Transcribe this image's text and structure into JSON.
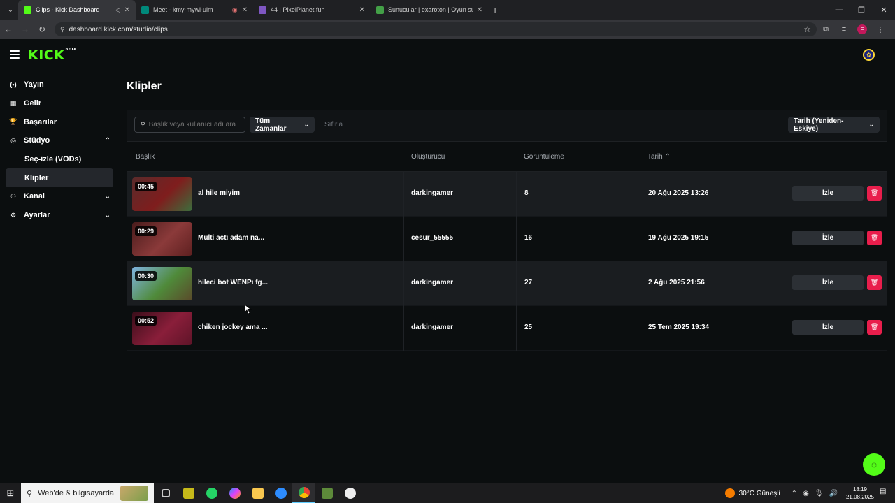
{
  "browser": {
    "tabs": [
      {
        "title": "Clips - Kick Dashboard",
        "favicon_color": "#53fc18",
        "active": true
      },
      {
        "title": "Meet - kmy-mywi-uim",
        "favicon_color": "#00897b",
        "active": false
      },
      {
        "title": "44 | PixelPlanet.fun",
        "favicon_color": "#7e57c2",
        "active": false
      },
      {
        "title": "Sunucular | exaroton | Oyun sunu",
        "favicon_color": "#43a047",
        "active": false
      }
    ],
    "url": "dashboard.kick.com/studio/clips",
    "profile_initial": "F"
  },
  "app": {
    "logo": "KICK",
    "logo_badge": "BETA",
    "brand_color": "#53fc18",
    "sidebar": [
      {
        "label": "Yayın",
        "icon": "broadcast-icon",
        "glyph": "(•)"
      },
      {
        "label": "Gelir",
        "icon": "revenue-icon",
        "glyph": "▦"
      },
      {
        "label": "Başarılar",
        "icon": "trophy-icon",
        "glyph": "🏆"
      },
      {
        "label": "Stüdyo",
        "icon": "studio-icon",
        "glyph": "◎",
        "chevron": "up"
      },
      {
        "label": "Seç-izle (VODs)",
        "sub": true
      },
      {
        "label": "Klipler",
        "sub": true,
        "active": true
      },
      {
        "label": "Kanal",
        "icon": "channel-icon",
        "glyph": "⚇",
        "chevron": "down"
      },
      {
        "label": "Ayarlar",
        "icon": "settings-icon",
        "glyph": "⚙",
        "chevron": "down"
      }
    ],
    "page_title": "Klipler",
    "filters": {
      "search_placeholder": "Başlık veya kullanıcı adı ara",
      "time_filter": "Tüm Zamanlar",
      "reset": "Sıfırla",
      "sort": "Tarih (Yeniden-Eskiye)"
    },
    "table": {
      "headers": {
        "title": "Başlık",
        "creator": "Oluşturucu",
        "views": "Görüntüleme",
        "date": "Tarih"
      },
      "watch_label": "İzle",
      "rows": [
        {
          "duration": "00:45",
          "title": "al hile miyim",
          "creator": "darkingamer",
          "views": "8",
          "date": "20 Ağu 2025 13:26",
          "thumb": [
            "#5a2b2b",
            "#7f1d1d",
            "#3c6e3c"
          ]
        },
        {
          "duration": "00:29",
          "title": "Multi actı adam na...",
          "creator": "cesur_55555",
          "views": "16",
          "date": "19 Ağu 2025 19:15",
          "thumb": [
            "#4a1c1c",
            "#8b3a3a",
            "#5e2020"
          ]
        },
        {
          "duration": "00:30",
          "title": "hileci bot WENPı fg...",
          "creator": "darkingamer",
          "views": "27",
          "date": "2 Ağu 2025 21:56",
          "thumb": [
            "#7fb3e0",
            "#4f8a3a",
            "#5a4a2a"
          ]
        },
        {
          "duration": "00:52",
          "title": "chiken jockey ama ...",
          "creator": "darkingamer",
          "views": "25",
          "date": "25 Tem 2025 19:34",
          "thumb": [
            "#3a0e1a",
            "#8a1e3a",
            "#5e1428"
          ]
        }
      ]
    }
  },
  "taskbar": {
    "search_label": "Web'de & bilgisayarda",
    "weather": "30°C",
    "weather_desc": "Güneşli",
    "time": "18:19",
    "date": "21.08.2025"
  }
}
